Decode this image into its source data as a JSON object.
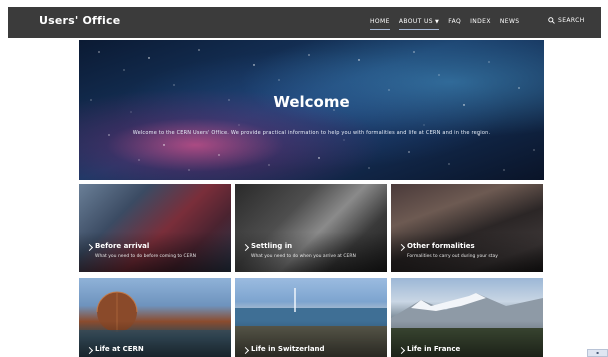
{
  "brand": "Users' Office",
  "nav": {
    "items": [
      {
        "label": "HOME",
        "active": true
      },
      {
        "label": "ABOUT US",
        "active": true,
        "has_dropdown": true
      },
      {
        "label": "FAQ",
        "active": false
      },
      {
        "label": "INDEX",
        "active": false
      },
      {
        "label": "NEWS",
        "active": false
      }
    ],
    "search_label": "SEARCH",
    "search_icon": "search-icon"
  },
  "hero": {
    "title": "Welcome",
    "subtitle": "Welcome to the CERN Users' Office. We provide practical information to help you with formalities and life at CERN and in the region."
  },
  "tiles": [
    {
      "title": "Before arrival",
      "desc": "What you need to do before coming to CERN"
    },
    {
      "title": "Settling in",
      "desc": "What you need to do when you arrive at CERN"
    },
    {
      "title": "Other formalities",
      "desc": "Formalities to carry out during your stay"
    },
    {
      "title": "Life at CERN",
      "desc": ""
    },
    {
      "title": "Life in Switzerland",
      "desc": ""
    },
    {
      "title": "Life in France",
      "desc": ""
    }
  ],
  "colors": {
    "topbar": "#3b3b3b",
    "active_underline": "#a8b9d6"
  }
}
